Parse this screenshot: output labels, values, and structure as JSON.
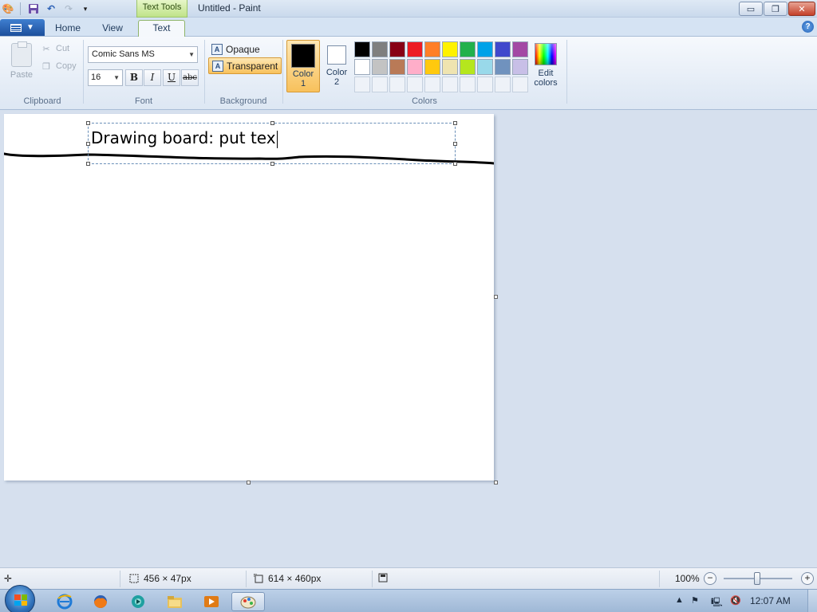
{
  "window": {
    "title": "Untitled - Paint",
    "context_tab": "Text Tools",
    "minimize_glyph": "▭",
    "maximize_glyph": "❐",
    "close_glyph": "✕"
  },
  "tabs": {
    "home": "Home",
    "view": "View",
    "text": "Text",
    "active": "Text"
  },
  "help_glyph": "?",
  "clipboard": {
    "paste": "Paste",
    "cut": "Cut",
    "copy": "Copy",
    "group_label": "Clipboard"
  },
  "font": {
    "family": "Comic Sans MS",
    "size": "16",
    "bold": "B",
    "italic": "I",
    "underline": "U",
    "strikethrough": "abc",
    "group_label": "Font"
  },
  "background": {
    "opaque": "Opaque",
    "transparent": "Transparent",
    "selected": "Transparent",
    "group_label": "Background"
  },
  "colors": {
    "color1_label_top": "Color",
    "color1_label_bottom": "1",
    "color1_value": "#000000",
    "color2_label_top": "Color",
    "color2_label_bottom": "2",
    "color2_value": "#ffffff",
    "edit_top": "Edit",
    "edit_bottom": "colors",
    "group_label": "Colors",
    "palette_row1": [
      "#000000",
      "#7f7f7f",
      "#880015",
      "#ed1c24",
      "#ff7f27",
      "#fff200",
      "#22b14c",
      "#00a2e8",
      "#3f48cc",
      "#a349a4"
    ],
    "palette_row2": [
      "#ffffff",
      "#c3c3c3",
      "#b97a57",
      "#ffaec9",
      "#ffc90e",
      "#efe4b0",
      "#b5e61d",
      "#99d9ea",
      "#7092be",
      "#c8bfe7"
    ],
    "palette_row3_empty": 10
  },
  "canvas": {
    "text": "Drawing board: put tex",
    "background": "#ffffff"
  },
  "status": {
    "selection_size": "456 × 47px",
    "image_size": "614 × 460px",
    "zoom": "100%",
    "zoom_out": "−",
    "zoom_in": "+"
  },
  "taskbar": {
    "icons": [
      "internet-explorer-icon",
      "firefox-icon",
      "media-player-icon",
      "file-explorer-icon",
      "media-center-icon",
      "paint-icon"
    ],
    "clock": "12:07 AM"
  }
}
